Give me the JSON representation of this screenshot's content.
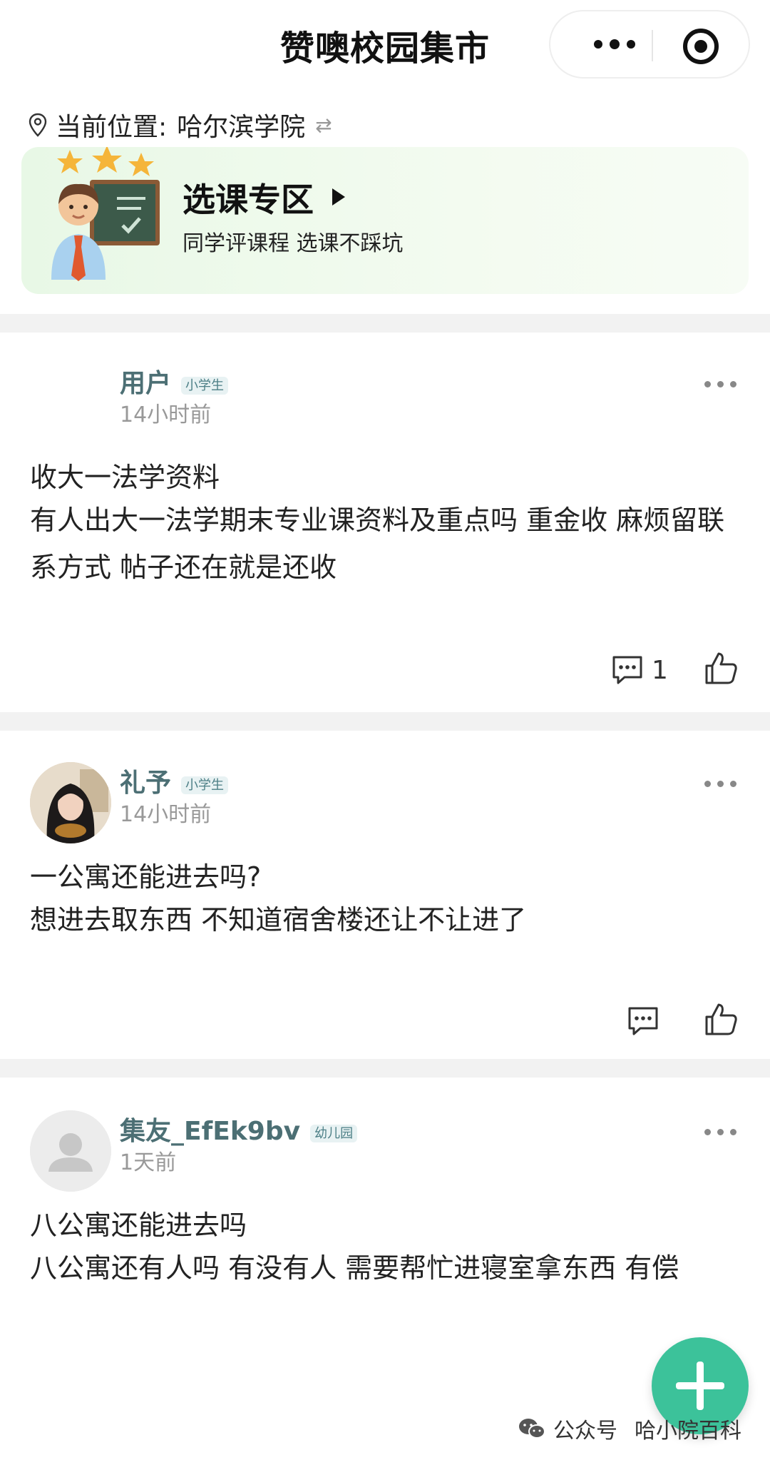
{
  "header": {
    "title": "赞噢校园集市"
  },
  "location": {
    "label": "当前位置:",
    "school": "哈尔滨学院",
    "swap_icon": "⇄"
  },
  "banner": {
    "title": "选课专区",
    "subtitle": "同学评课程 选课不踩坑"
  },
  "posts": [
    {
      "username": "用户",
      "badge": "小学生",
      "time": "14小时前",
      "title": "收大一法学资料",
      "body": "有人出大一法学期末专业课资料及重点吗 重金收 麻烦留联系方式 帖子还在就是还收",
      "comment_count": "1"
    },
    {
      "username": "礼予",
      "badge": "小学生",
      "time": "14小时前",
      "title": "一公寓还能进去吗?",
      "body": "想进去取东西 不知道宿舍楼还让不让进了",
      "comment_count": ""
    },
    {
      "username": "集友_EfEk9bv",
      "badge": "幼儿园",
      "time": "1天前",
      "title": "八公寓还能进去吗",
      "body": "八公寓还有人吗 有没有人 需要帮忙进寝室拿东西 有偿",
      "comment_count": ""
    }
  ],
  "watermark": {
    "label": "公众号",
    "name": "哈小院百科"
  },
  "colors": {
    "accent": "#3cc29a",
    "username": "#4c6f74",
    "banner_bg": "#e8f8e6"
  }
}
